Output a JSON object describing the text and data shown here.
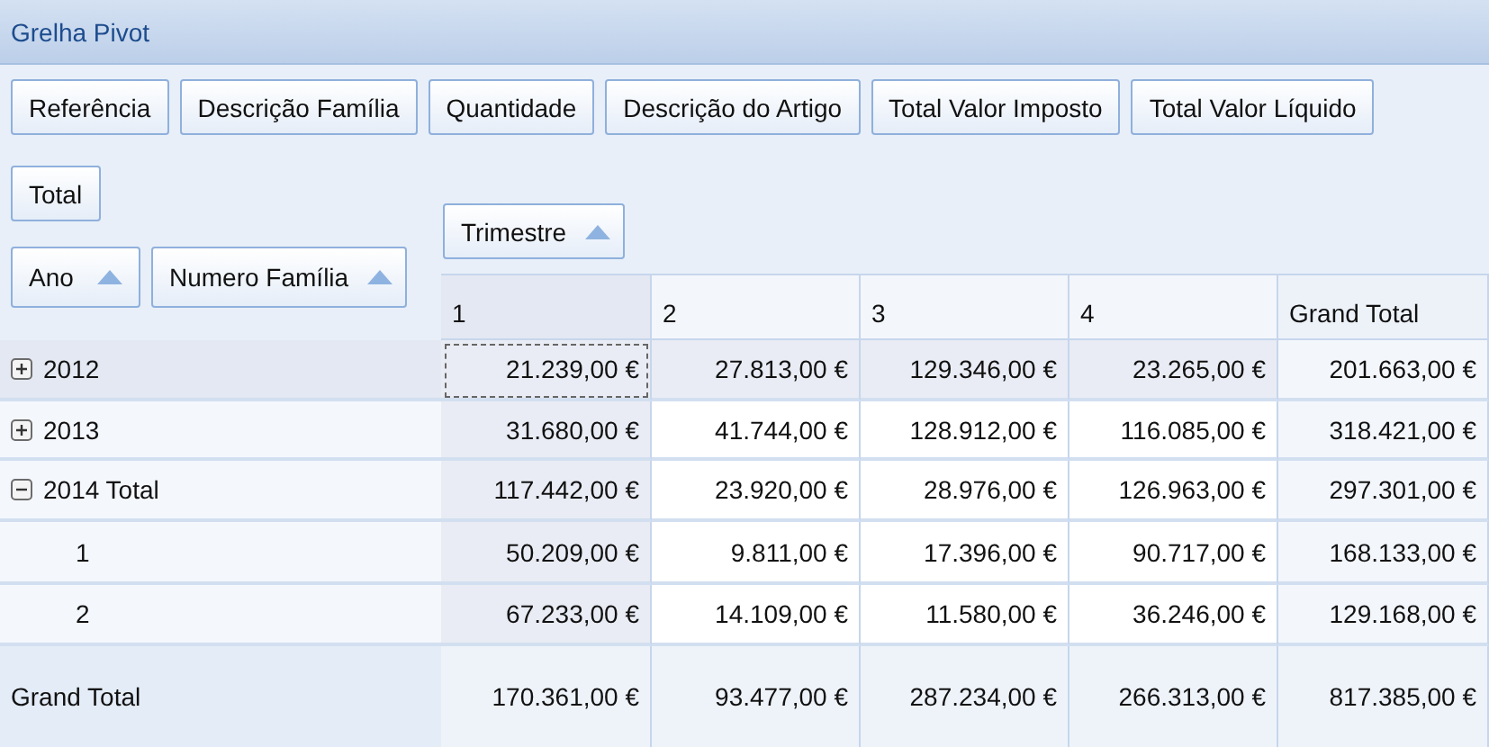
{
  "window": {
    "title": "Grelha Pivot"
  },
  "filter_fields": [
    "Referência",
    "Descrição Família",
    "Quantidade",
    "Descrição do Artigo",
    "Total Valor Imposto",
    "Total Valor Líquido"
  ],
  "data_fields": [
    "Total"
  ],
  "column_fields": [
    {
      "label": "Trimestre",
      "sorted": true
    }
  ],
  "row_fields": [
    {
      "label": "Ano",
      "sorted": true
    },
    {
      "label": "Numero Família",
      "sorted": true
    }
  ],
  "table": {
    "columns": [
      {
        "label": "1",
        "kind": "value",
        "selected": true
      },
      {
        "label": "2",
        "kind": "value",
        "selected": false
      },
      {
        "label": "3",
        "kind": "value",
        "selected": false
      },
      {
        "label": "4",
        "kind": "value",
        "selected": false
      },
      {
        "label": "Grand Total",
        "kind": "total",
        "selected": false
      }
    ],
    "rows": [
      {
        "label": "2012",
        "expanded": false,
        "selected": true,
        "values": [
          "21.239,00 €",
          "27.813,00 €",
          "129.346,00 €",
          "23.265,00 €",
          "201.663,00 €"
        ]
      },
      {
        "label": "2013",
        "expanded": false,
        "selected": false,
        "values": [
          "31.680,00 €",
          "41.744,00 €",
          "128.912,00 €",
          "116.085,00 €",
          "318.421,00 €"
        ]
      },
      {
        "label": "2014 Total",
        "expanded": true,
        "selected": false,
        "values": [
          "117.442,00 €",
          "23.920,00 €",
          "28.976,00 €",
          "126.963,00 €",
          "297.301,00 €"
        ],
        "children": [
          {
            "label": "1",
            "selected": false,
            "values": [
              "50.209,00 €",
              "9.811,00 €",
              "17.396,00 €",
              "90.717,00 €",
              "168.133,00 €"
            ]
          },
          {
            "label": "2",
            "selected": false,
            "values": [
              "67.233,00 €",
              "14.109,00 €",
              "11.580,00 €",
              "36.246,00 €",
              "129.168,00 €"
            ]
          }
        ]
      }
    ],
    "grand_total": {
      "label": "Grand Total",
      "values": [
        "170.361,00 €",
        "93.477,00 €",
        "287.234,00 €",
        "266.313,00 €",
        "817.385,00 €"
      ]
    }
  }
}
